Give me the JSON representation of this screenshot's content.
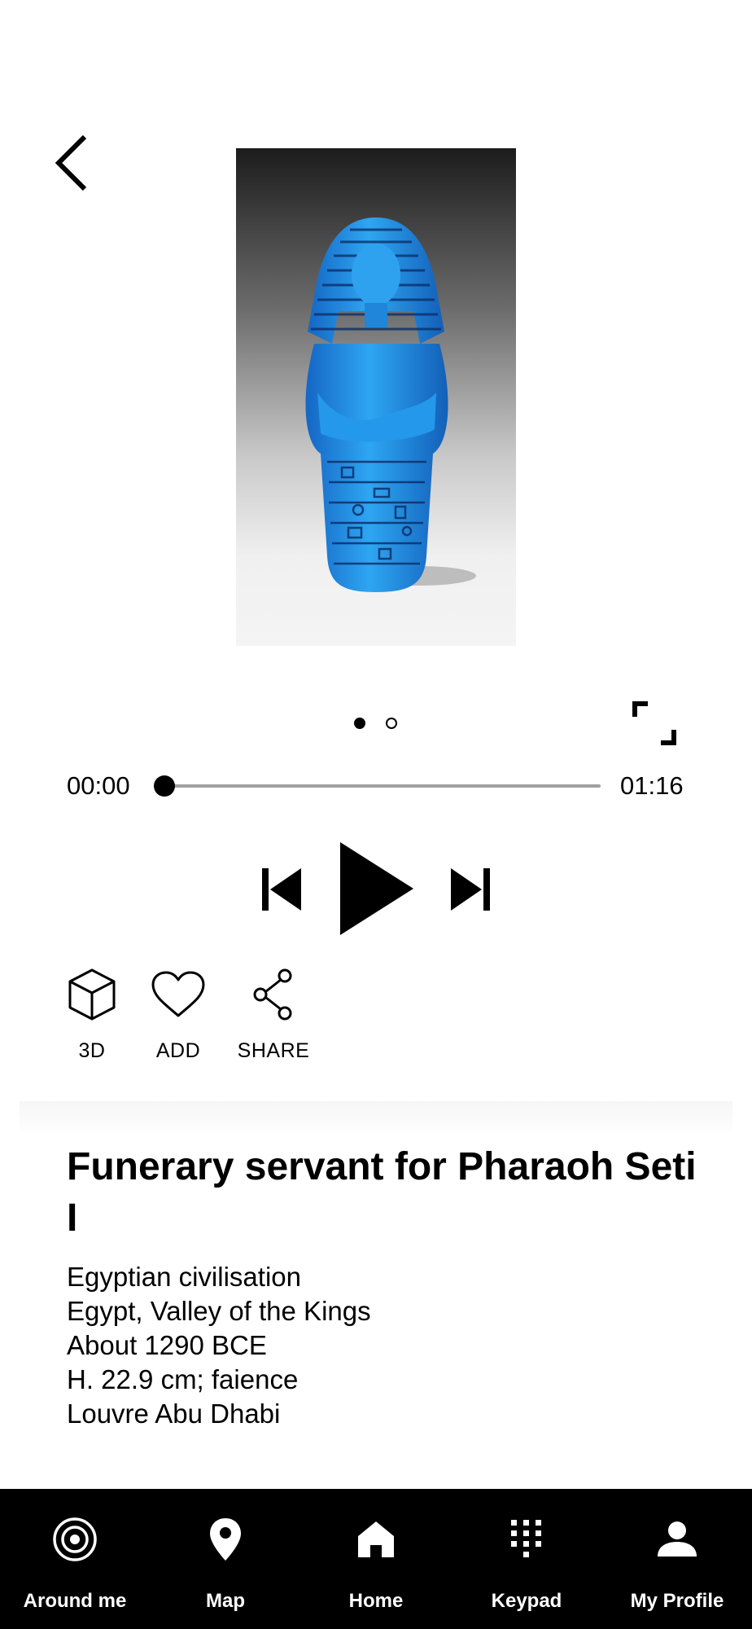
{
  "header": {
    "back_icon": "chevron-left-icon"
  },
  "artwork": {
    "image_subject": "blue faience funerary servant statuette",
    "pager": {
      "count": 2,
      "active_index": 0
    },
    "fullscreen_icon": "expand-corners-icon"
  },
  "audio": {
    "current_time": "00:00",
    "total_time": "01:16",
    "progress": 0,
    "icons": {
      "previous": "skip-previous-icon",
      "play": "play-icon",
      "next": "skip-next-icon"
    }
  },
  "actions": [
    {
      "label": "3D",
      "icon": "cube-icon"
    },
    {
      "label": "ADD",
      "icon": "heart-icon"
    },
    {
      "label": "SHARE",
      "icon": "share-icon"
    }
  ],
  "info": {
    "title": "Funerary servant for Pharaoh Seti I",
    "details": [
      "Egyptian civilisation",
      "Egypt, Valley of the Kings",
      "About 1290 BCE",
      "H. 22.9 cm; faience",
      "Louvre Abu Dhabi"
    ]
  },
  "nav": {
    "items": [
      {
        "label": "Around me",
        "icon": "target-icon"
      },
      {
        "label": "Map",
        "icon": "map-pin-icon"
      },
      {
        "label": "Home",
        "icon": "home-icon"
      },
      {
        "label": "Keypad",
        "icon": "keypad-icon"
      },
      {
        "label": "My Profile",
        "icon": "profile-icon"
      }
    ]
  },
  "colors": {
    "background": "#ffffff",
    "nav_background": "#000000",
    "figure_blue": "#1e8fe0",
    "track": "#a0a0a0"
  }
}
